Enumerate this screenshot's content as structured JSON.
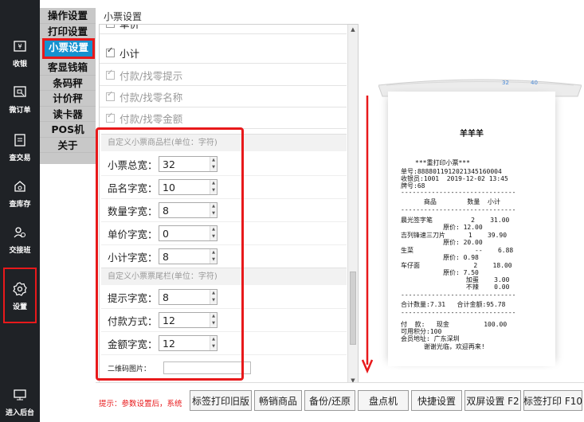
{
  "sidebar": {
    "items": [
      {
        "label": "收银",
        "icon": "cash-register-icon"
      },
      {
        "label": "微订单",
        "icon": "micro-order-icon"
      },
      {
        "label": "查交易",
        "icon": "transaction-query-icon"
      },
      {
        "label": "查库存",
        "icon": "inventory-query-icon"
      },
      {
        "label": "交接班",
        "icon": "shift-handover-icon"
      },
      {
        "label": "设置",
        "icon": "gear-icon"
      },
      {
        "label": "进入后台",
        "icon": "monitor-icon"
      }
    ]
  },
  "categories": {
    "items": [
      "操作设置",
      "打印设置",
      "小票设置",
      "客显钱箱",
      "条码秤",
      "计价秤",
      "读卡器",
      "POS机",
      "关于"
    ],
    "active": "小票设置"
  },
  "content": {
    "title": "小票设置",
    "checkboxes": [
      {
        "label": "单价",
        "checked": false,
        "disabled": false
      },
      {
        "label": "小计",
        "checked": true,
        "disabled": false
      },
      {
        "label": "付款/找零提示",
        "checked": true,
        "disabled": true
      },
      {
        "label": "付款/找零名称",
        "checked": true,
        "disabled": true
      },
      {
        "label": "付款/找零金额",
        "checked": true,
        "disabled": true
      }
    ],
    "section_items": {
      "heading": "自定义小票商品栏(单位：字符)",
      "fields": [
        {
          "label": "小票总宽：",
          "value": "32"
        },
        {
          "label": "品名字宽：",
          "value": "10"
        },
        {
          "label": "数量字宽：",
          "value": "8"
        },
        {
          "label": "单价字宽：",
          "value": "0"
        },
        {
          "label": "小计字宽：",
          "value": "8"
        }
      ]
    },
    "section_footer": {
      "heading": "自定义小票票尾栏(单位：字符)",
      "fields": [
        {
          "label": "提示字宽：",
          "value": "8"
        },
        {
          "label": "付款方式：",
          "value": "12"
        },
        {
          "label": "金额字宽：",
          "value": "12"
        }
      ]
    },
    "qr_label": "二维码图片："
  },
  "ruler": {
    "mark1": "32",
    "mark2": "40"
  },
  "receipt": {
    "store": "羊羊羊",
    "lines": [
      "***重打印小票***",
      "单号:8888011912021345160004",
      "收银员:1001  2019-12-02 13:45",
      "牌号:68",
      "------------------------------",
      "      商品        数量  小计",
      "------------------------------",
      "晨光签字笔          2    31.00",
      "           原价: 12.00",
      "吉列锋速三刀片      1    39.90",
      "           原价: 20.00",
      "生菜                --    6.88",
      "           原价: 0.98",
      "车仔面              2    18.00",
      "           原价: 7.50",
      "                 加蛋    3.00",
      "                 不辣    0.00",
      "------------------------------",
      "合计数量:7.31   合计金额:95.78",
      "------------------------------",
      "付  款:   现金         100.00",
      "可用积分:100",
      "会员地址: 广东深圳",
      "      谢谢光临，欢迎再来!"
    ]
  },
  "bottom": {
    "hint": "提示：参数设置后，系统",
    "buttons": [
      "标签打印旧版",
      "畅销商品",
      "备份/还原",
      "盘点机",
      "快捷设置",
      "双屏设置 F2",
      "标签打印 F10"
    ]
  },
  "colors": {
    "accent": "#1591cf",
    "highlight": "#e8191b",
    "sidebar": "#1f2226"
  }
}
